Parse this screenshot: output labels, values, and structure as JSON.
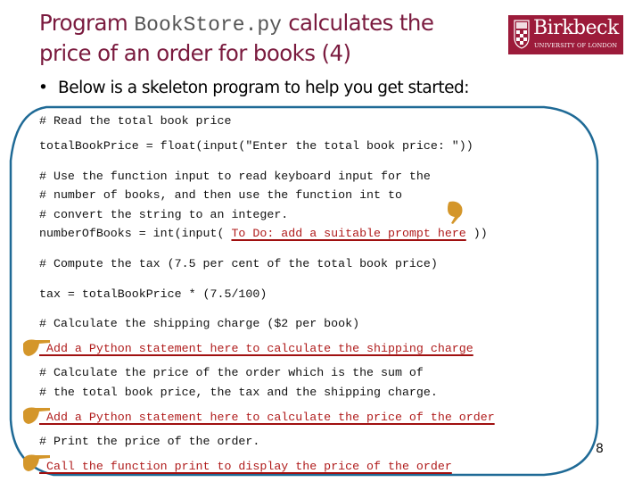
{
  "slide": {
    "title_prefix": "Program ",
    "title_filename": "BookStore.py",
    "title_suffix": " calculates the",
    "title_line2": "price of an order for books (4)",
    "page_number": "8"
  },
  "logo": {
    "name": "Birkbeck",
    "subtitle": "UNIVERSITY OF LONDON",
    "icon": "crest-icon",
    "color": "#9c1b3a"
  },
  "bullet": {
    "icon": "bullet-dot",
    "text": "Below is a skeleton program to help you get started:"
  },
  "colors": {
    "title": "#7a1a3e",
    "frame": "#1f6a96",
    "todo": "#b01c1c",
    "hand": "#d4962a"
  },
  "code": {
    "line1": "# Read the total book price",
    "line2": "totalBookPrice = float(input(\"Enter the total book price: \"))",
    "line3": "# Use the function input to read keyboard input for the",
    "line4": "# number of books, and then use the function int to",
    "line5": "# convert the string to an integer.",
    "line6_pre": "numberOfBooks = int(input( ",
    "line6_todo": "To Do: add a suitable prompt here",
    "line6_post": " ))",
    "line7": "# Compute the tax (7.5 per cent of the total book price)",
    "line8": "tax = totalBookPrice * (7.5/100)",
    "line9": "# Calculate the shipping charge ($2 per book)",
    "line10_todo": " Add a Python statement here to calculate the shipping charge",
    "line11": "# Calculate the price of the order which is the sum of",
    "line12": "# the total book price, the tax and the shipping charge.",
    "line13_todo": " Add a Python statement here to calculate the price of the order",
    "line14": "# Print the price of the order.",
    "line15_todo": " Call the function print to display the price of the order"
  }
}
